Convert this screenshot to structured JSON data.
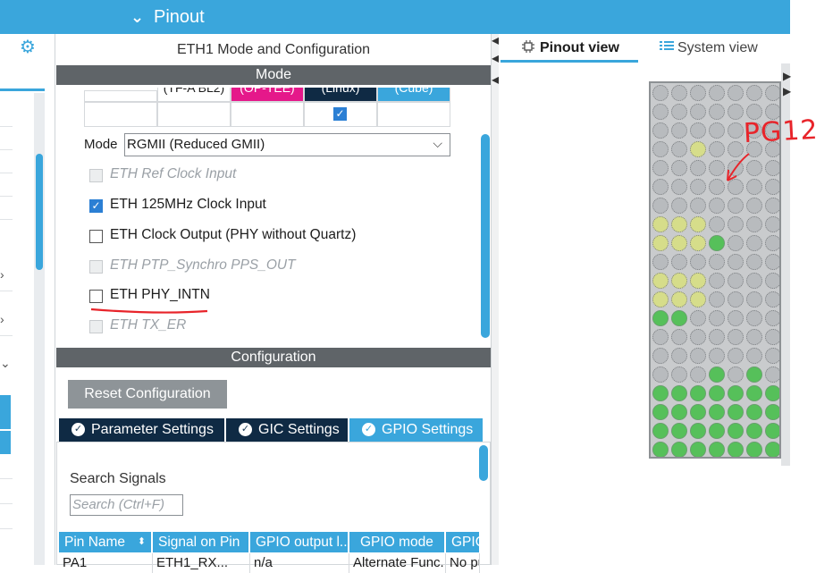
{
  "header": {
    "title": "Pinout",
    "chevron_icon": "chevron-down-icon"
  },
  "left_panel": {
    "gear_icon": "gear-icon"
  },
  "center": {
    "title": "ETH1 Mode and Configuration",
    "mode_section_title": "Mode",
    "table": {
      "row1": [
        "(TF-A BL2)",
        "(OP-TEE)",
        "(Linux)",
        "(Cube)"
      ],
      "linux_checked": true
    },
    "mode_label": "Mode",
    "mode_value": "RGMII (Reduced GMII)",
    "checkboxes": [
      {
        "label": "ETH Ref Clock Input",
        "checked": false,
        "disabled": true
      },
      {
        "label": "ETH 125MHz Clock Input",
        "checked": true,
        "disabled": false
      },
      {
        "label": "ETH Clock Output (PHY without Quartz)",
        "checked": false,
        "disabled": false
      },
      {
        "label": "ETH PTP_Synchro PPS_OUT",
        "checked": false,
        "disabled": true
      },
      {
        "label": "ETH PHY_INTN",
        "checked": false,
        "disabled": false
      },
      {
        "label": "ETH TX_ER",
        "checked": false,
        "disabled": true
      }
    ],
    "config_section_title": "Configuration",
    "reset_button": "Reset Configuration",
    "tabs": [
      "Parameter Settings",
      "GIC Settings",
      "GPIO Settings"
    ],
    "active_tab": "GPIO Settings",
    "search_label": "Search Signals",
    "search_placeholder": "Search (Ctrl+F)",
    "table_headers": [
      "Pin Name",
      "Signal on Pin",
      "GPIO output l...",
      "GPIO mode",
      "GPIO"
    ],
    "table_rows": [
      [
        "PA1",
        "ETH1_RX...",
        "n/a",
        "Alternate Func...",
        "No pu"
      ]
    ]
  },
  "right": {
    "tabs": [
      "Pinout view",
      "System view"
    ],
    "active_tab": "Pinout view",
    "annotation": "PG12"
  },
  "colors": {
    "accent": "#3aa6dc",
    "tab_dark": "#0f2a44",
    "highlight_pink": "#e5188a",
    "annotation_red": "#e8242a",
    "pin_green": "#56c05a",
    "pin_yellow": "#d6dd8a"
  }
}
